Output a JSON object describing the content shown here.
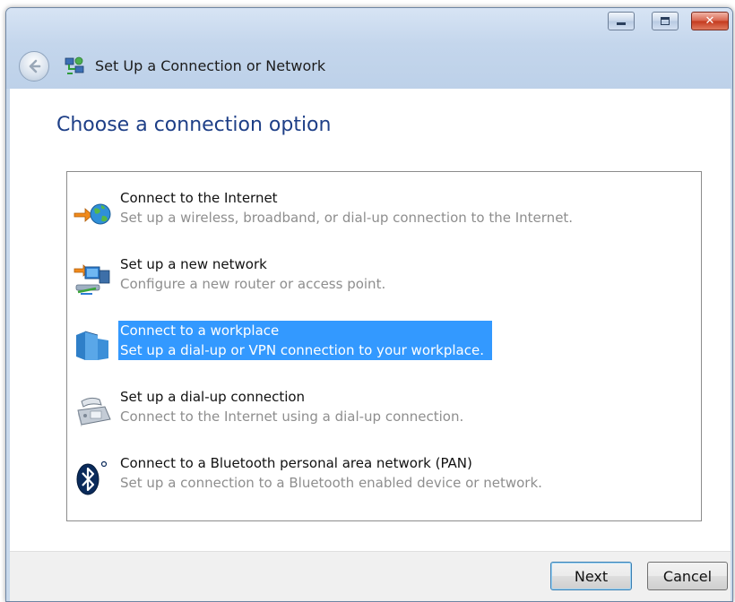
{
  "window": {
    "title": "Set Up a Connection or Network",
    "controls": {
      "minimize": "minimize",
      "maximize": "maximize",
      "close": "close"
    }
  },
  "main": {
    "heading": "Choose a connection option",
    "options": [
      {
        "title": "Connect to the Internet",
        "description": "Set up a wireless, broadband, or dial-up connection to the Internet.",
        "icon": "internet-globe-icon",
        "selected": false
      },
      {
        "title": "Set up a new network",
        "description": "Configure a new router or access point.",
        "icon": "new-network-icon",
        "selected": false
      },
      {
        "title": "Connect to a workplace",
        "description": "Set up a dial-up or VPN connection to your workplace.",
        "icon": "workplace-building-icon",
        "selected": true
      },
      {
        "title": "Set up a dial-up connection",
        "description": "Connect to the Internet using a dial-up connection.",
        "icon": "dialup-phone-icon",
        "selected": false
      },
      {
        "title": "Connect to a Bluetooth personal area network (PAN)",
        "description": "Set up a connection to a Bluetooth enabled device or network.",
        "icon": "bluetooth-icon",
        "selected": false
      }
    ]
  },
  "footer": {
    "next_label": "Next",
    "cancel_label": "Cancel"
  },
  "colors": {
    "selection": "#3399ff",
    "heading": "#1e3f87",
    "description": "#8e8e8e"
  }
}
